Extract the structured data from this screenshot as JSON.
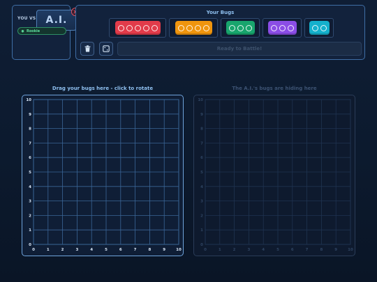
{
  "opponent": {
    "you_vs_label": "YOU VS",
    "opponent_name": "A.I.",
    "difficulty": "Rookie"
  },
  "bugs_panel": {
    "title": "Your Bugs",
    "bugs": [
      {
        "name": "red-bug",
        "size": 5,
        "color": "#e23b4a"
      },
      {
        "name": "orange-bug",
        "size": 4,
        "color": "#f0950e"
      },
      {
        "name": "green-bug",
        "size": 3,
        "color": "#18a56d"
      },
      {
        "name": "purple-bug",
        "size": 3,
        "color": "#8b4de6"
      },
      {
        "name": "cyan-bug",
        "size": 2,
        "color": "#14b0cc"
      }
    ],
    "ready_label": "Ready to Battle!"
  },
  "player_board": {
    "title": "Drag your bugs here - click to rotate",
    "x_ticks": [
      "0",
      "1",
      "2",
      "3",
      "4",
      "5",
      "6",
      "7",
      "8",
      "9",
      "10"
    ],
    "y_ticks": [
      "0",
      "1",
      "2",
      "3",
      "4",
      "5",
      "6",
      "7",
      "8",
      "9",
      "10"
    ]
  },
  "ai_board": {
    "title": "The A.I.'s bugs are hiding here",
    "x_ticks": [
      "0",
      "1",
      "2",
      "3",
      "4",
      "5",
      "6",
      "7",
      "8",
      "9",
      "10"
    ],
    "y_ticks": [
      "0",
      "1",
      "2",
      "3",
      "4",
      "5",
      "6",
      "7",
      "8",
      "9",
      "10"
    ]
  },
  "colors": {
    "accent": "#8fc0f0",
    "danger": "#e05060",
    "success": "#5fe0a0"
  }
}
